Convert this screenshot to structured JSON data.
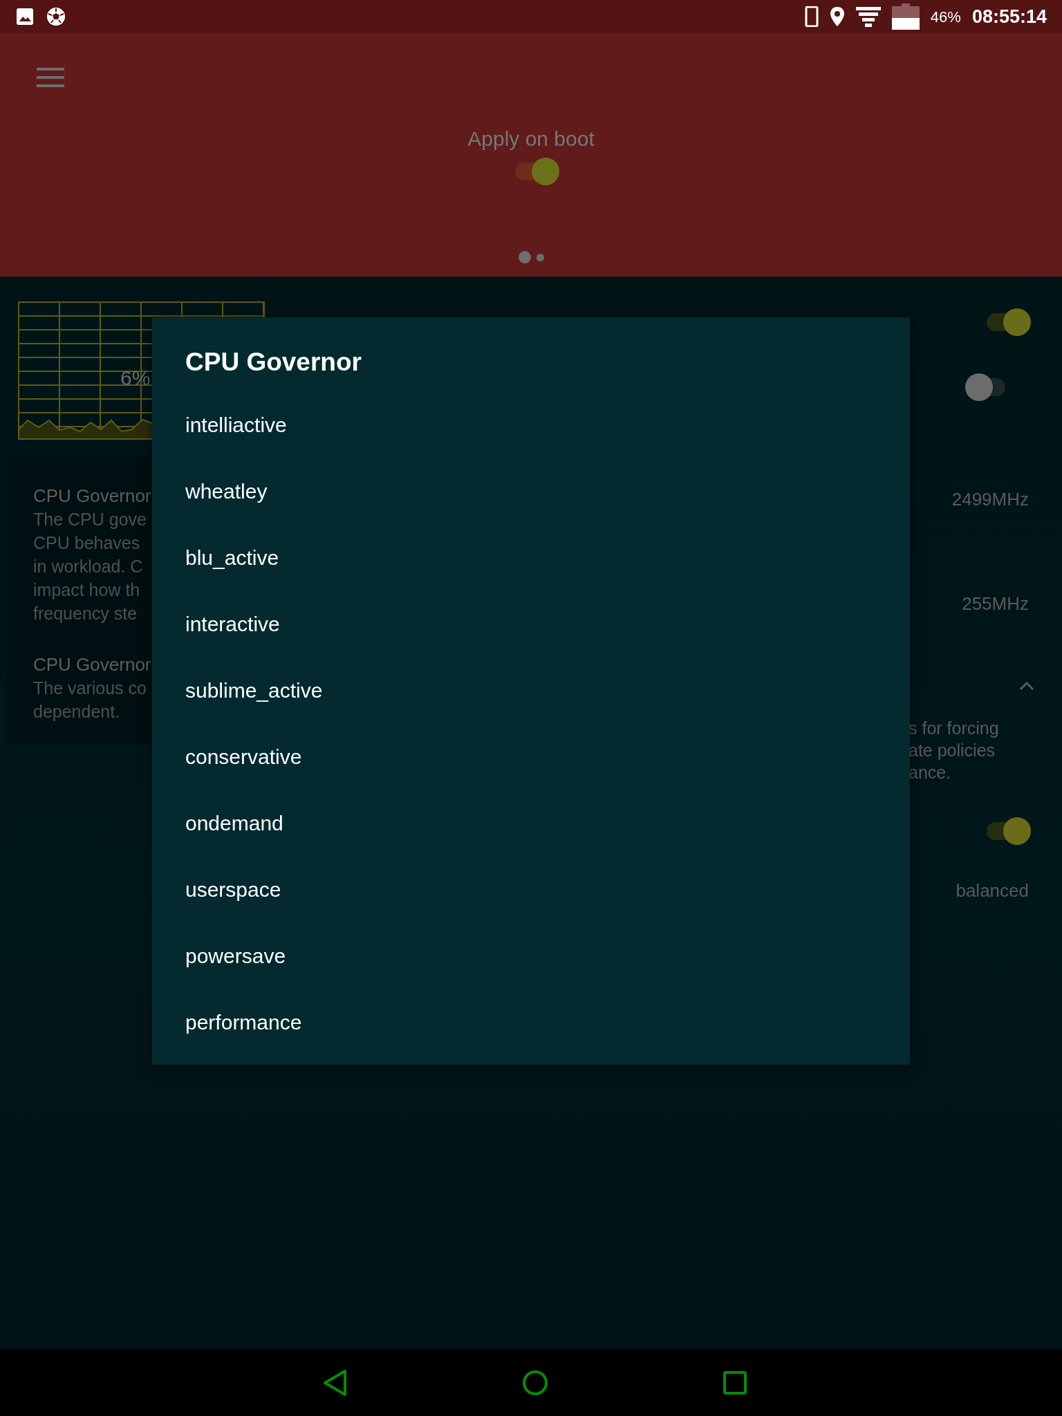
{
  "status_bar": {
    "battery": "46%",
    "time": "08:55:14"
  },
  "header": {
    "title": "Apply on boot",
    "apply_on_boot": {
      "on": true
    },
    "pages": [
      {
        "selected": true
      },
      {
        "selected": false
      }
    ]
  },
  "cpu_graph": {
    "load": "6%"
  },
  "info_card": {
    "items": [
      {
        "title": "CPU Governor",
        "lines": [
          "The CPU gove",
          "CPU behaves",
          "in workload. C",
          "impact how th",
          "frequency ste"
        ]
      },
      {
        "title": "CPU Governor",
        "lines": [
          "The various co",
          "dependent."
        ]
      }
    ]
  },
  "right_panel": {
    "toggles": [
      {
        "on": true
      },
      {
        "on": false
      }
    ],
    "max_freq": "2499MHz",
    "min_freq": "255MHz",
    "section_expanded": true,
    "description_lines": [
      "s for forcing",
      "ate policies",
      "ance."
    ],
    "policy_toggle": {
      "on": true
    },
    "profile": "balanced"
  },
  "dialog": {
    "title": "CPU Governor",
    "options": [
      "intelliactive",
      "wheatley",
      "blu_active",
      "interactive",
      "sublime_active",
      "conservative",
      "ondemand",
      "userspace",
      "powersave",
      "performance"
    ]
  }
}
